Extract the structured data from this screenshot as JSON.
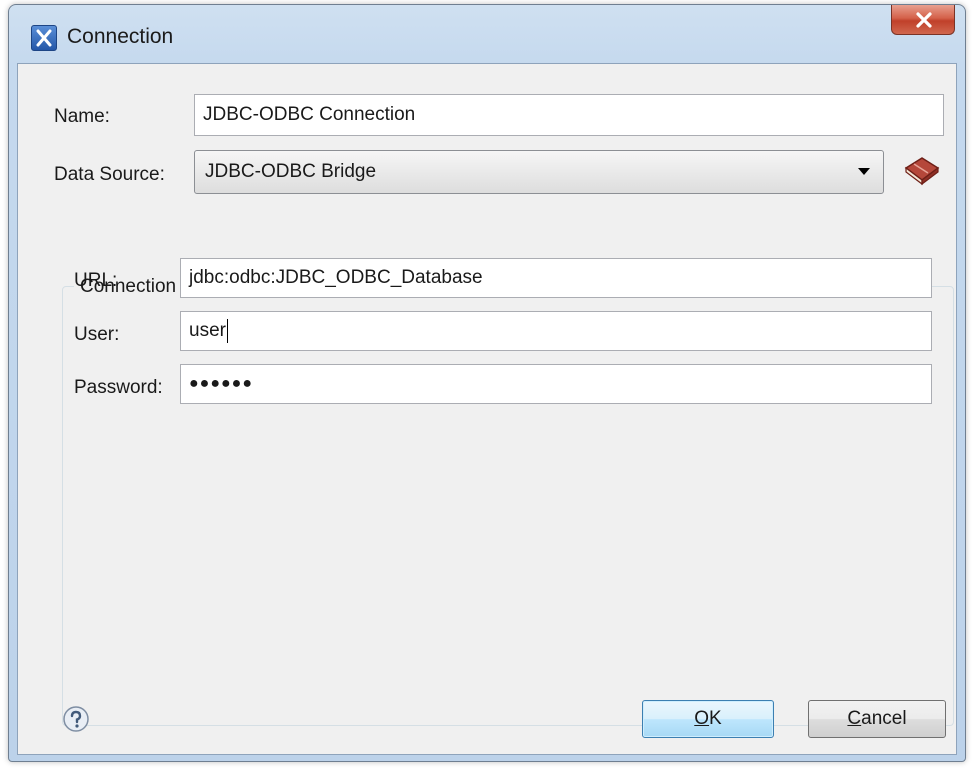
{
  "window": {
    "title": "Connection"
  },
  "form": {
    "name_label": "Name:",
    "name_value": "JDBC-ODBC Connection",
    "data_source_label": "Data Source:",
    "data_source_value": "JDBC-ODBC Bridge"
  },
  "details": {
    "group_title": "Connection Details",
    "url_label": "URL:",
    "url_value": "jdbc:odbc:JDBC_ODBC_Database",
    "user_label": "User:",
    "user_value": "user",
    "password_label": "Password:",
    "password_value": "●●●●●●"
  },
  "buttons": {
    "ok_mnemonic": "O",
    "ok_rest": "K",
    "cancel_mnemonic": "C",
    "cancel_rest": "ancel"
  },
  "icons": {
    "app": "oxygen-x-icon",
    "close": "close-icon",
    "dropdown": "chevron-down-icon",
    "data_source_config": "book-icon",
    "help": "help-icon"
  },
  "colors": {
    "titlebar": "#c5d9ee",
    "close_button": "#c0402a",
    "dialog_bg": "#f0f0f0",
    "default_button": "#bee6fd"
  }
}
